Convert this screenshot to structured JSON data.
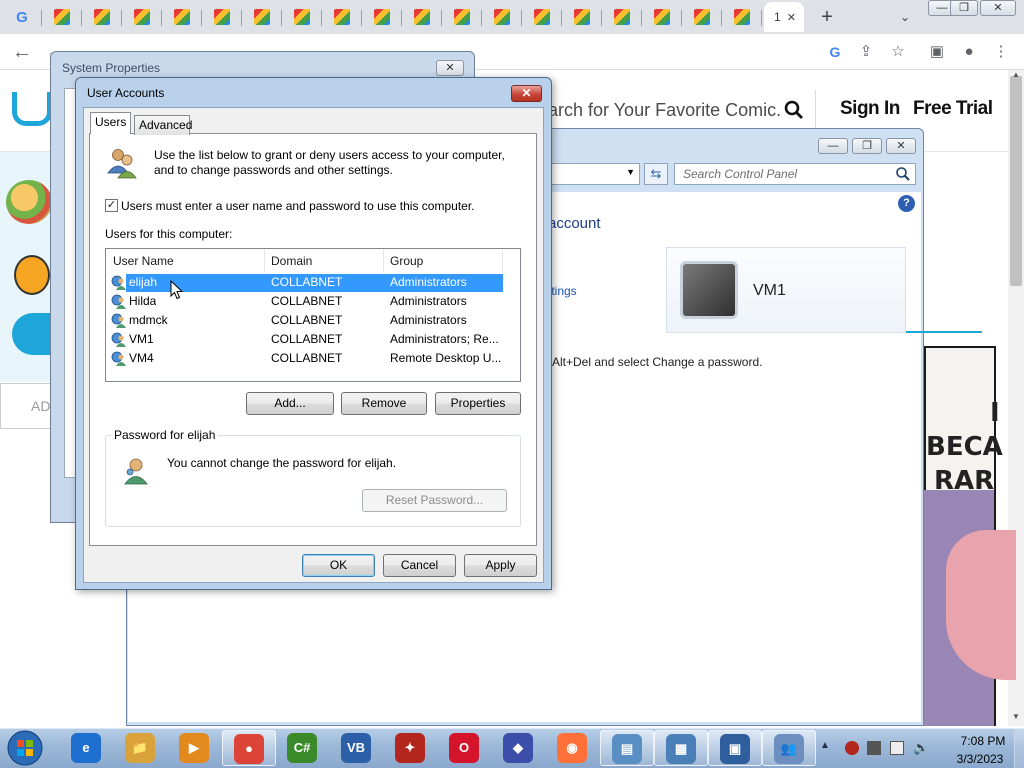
{
  "browser": {
    "active_tab_label": "1",
    "new_tab": "+",
    "tab_search": "⌄",
    "window_controls": {
      "minimize": "—",
      "maximize": "❐",
      "close": "✕"
    }
  },
  "site": {
    "search_placeholder": "arch for Your Favorite Comic.",
    "sign_in": "Sign In",
    "free_trial": "Free Trial",
    "ad_text": "AD",
    "comic_text_1": "I",
    "comic_text_2": "BECA",
    "comic_text_3": "RAR"
  },
  "control_panel": {
    "search_placeholder": "Search Control Panel",
    "help": "?",
    "heading": "account",
    "link": "ttings",
    "user_name": "VM1",
    "hint": "-Alt+Del and select Change a password."
  },
  "system_properties": {
    "title": "System Properties",
    "close": "✕"
  },
  "user_accounts": {
    "title": "User Accounts",
    "close": "✕",
    "tabs": [
      "Users",
      "Advanced"
    ],
    "description_line1": "Use the list below to grant or deny users access to your computer,",
    "description_line2": "and to change passwords and other settings.",
    "checkbox_label": "Users must enter a user name and password to use this computer.",
    "checkbox_mark": "✓",
    "list_label": "Users for this computer:",
    "columns": [
      "User Name",
      "Domain",
      "Group"
    ],
    "rows": [
      {
        "name": "elijah",
        "domain": "COLLABNET",
        "group": "Administrators"
      },
      {
        "name": "Hilda",
        "domain": "COLLABNET",
        "group": "Administrators"
      },
      {
        "name": "mdmck",
        "domain": "COLLABNET",
        "group": "Administrators"
      },
      {
        "name": "VM1",
        "domain": "COLLABNET",
        "group": "Administrators; Re..."
      },
      {
        "name": "VM4",
        "domain": "COLLABNET",
        "group": "Remote Desktop U..."
      }
    ],
    "buttons": {
      "add": "Add...",
      "remove": "Remove",
      "properties": "Properties"
    },
    "password_group_title": "Password for elijah",
    "password_message": "You cannot change the password for elijah.",
    "reset_password": "Reset Password...",
    "ok": "OK",
    "cancel": "Cancel",
    "apply": "Apply"
  },
  "taskbar": {
    "time": "7:08 PM",
    "date": "3/3/2023",
    "apps": [
      {
        "label": "e",
        "color": "#1f6fd1"
      },
      {
        "label": "📁",
        "color": "#d9a23b"
      },
      {
        "label": "▶",
        "color": "#e28a1e"
      },
      {
        "label": "●",
        "color": "#db4437"
      },
      {
        "label": "C#",
        "color": "#3a8a2a"
      },
      {
        "label": "VB",
        "color": "#2b5fa8"
      },
      {
        "label": "✦",
        "color": "#b3261e"
      },
      {
        "label": "O",
        "color": "#d4142a"
      },
      {
        "label": "◆",
        "color": "#3d4ea8"
      },
      {
        "label": "◉",
        "color": "#ff7139"
      },
      {
        "label": "▤",
        "color": "#5a8fc4"
      },
      {
        "label": "▦",
        "color": "#4a7fb8"
      },
      {
        "label": "▣",
        "color": "#2f5e9e"
      },
      {
        "label": "👥",
        "color": "#6c8fbf"
      }
    ]
  }
}
